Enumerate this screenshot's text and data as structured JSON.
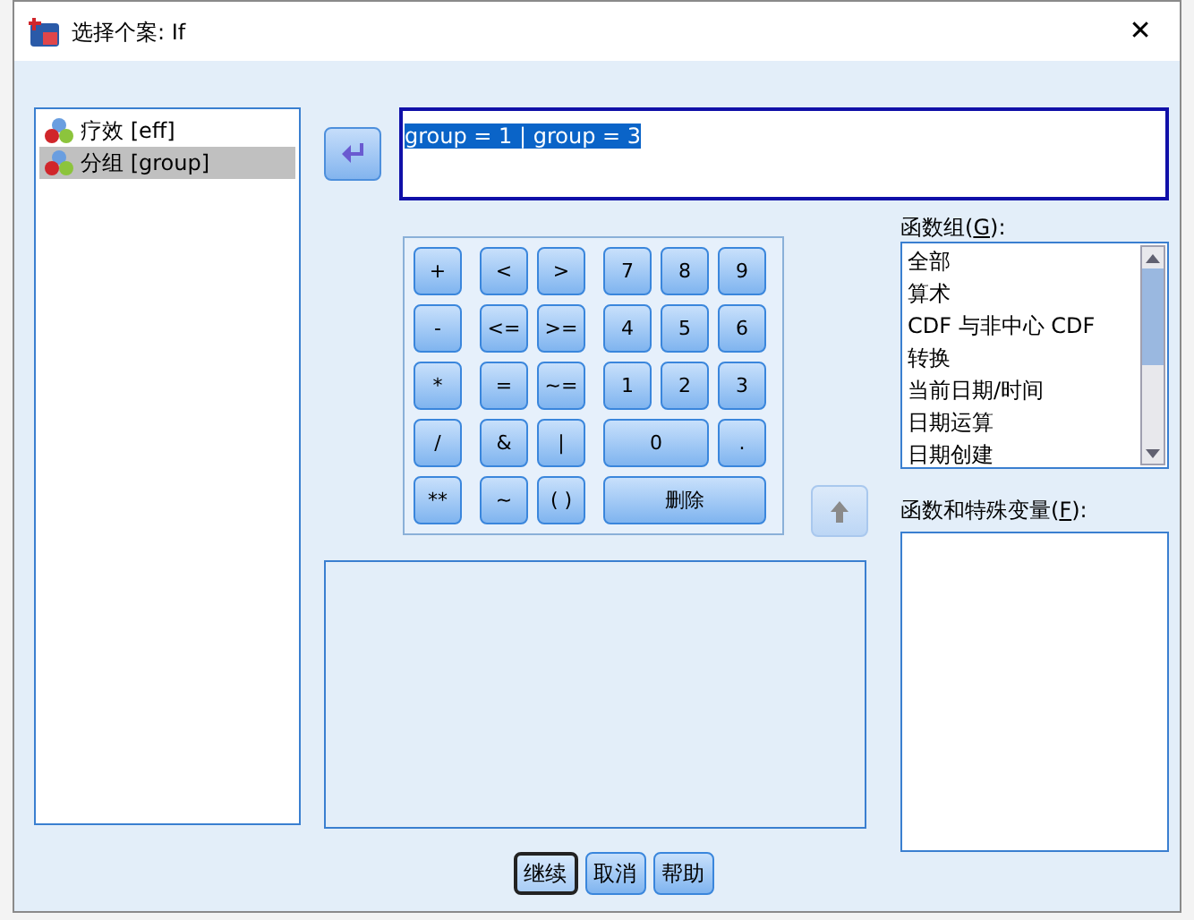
{
  "window": {
    "title": "选择个案: If",
    "close": "✕"
  },
  "variables": [
    {
      "label": "疗效 [eff]",
      "selected": false
    },
    {
      "label": "分组 [group]",
      "selected": true
    }
  ],
  "expression": {
    "value": "group = 1 | group = 3",
    "selected": true
  },
  "keypad": [
    "+",
    "<",
    ">",
    "7",
    "8",
    "9",
    "-",
    "<=",
    ">=",
    "4",
    "5",
    "6",
    "*",
    "=",
    "~=",
    "1",
    "2",
    "3",
    "/",
    "&",
    "|",
    "0",
    ".",
    "**",
    "~",
    "( )",
    "删除"
  ],
  "up_button": {
    "disabled": true
  },
  "function_group": {
    "label": "函数组(G):",
    "items": [
      "全部",
      "算术",
      "CDF 与非中心 CDF",
      "转换",
      "当前日期/时间",
      "日期运算",
      "日期创建"
    ]
  },
  "functions": {
    "label": "函数和特殊变量(F):"
  },
  "buttons": [
    {
      "label": "继续",
      "focused": true
    },
    {
      "label": "取消",
      "focused": false
    },
    {
      "label": "帮助",
      "focused": false
    }
  ]
}
